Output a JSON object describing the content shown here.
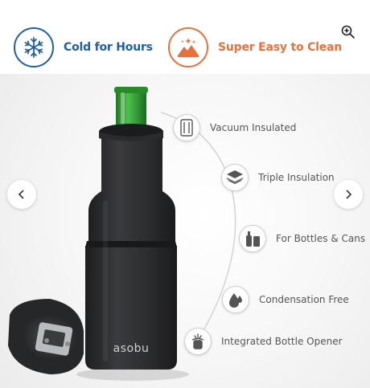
{
  "badges": {
    "cold": {
      "label": "Cold for Hours",
      "icon": "snowflake-icon",
      "color": "#1f5fa8"
    },
    "clean": {
      "label": "Super Easy to Clean",
      "icon": "sparkle-mountain-icon",
      "color": "#e8703a"
    }
  },
  "controls": {
    "zoom_icon": "zoom-in-icon",
    "prev_icon": "chevron-left-icon",
    "next_icon": "chevron-right-icon"
  },
  "product": {
    "brand": "asobu",
    "bottle_color": "#2c2d2f",
    "neck_color": "#2e9e2e"
  },
  "features": [
    {
      "label": "Vacuum Insulated",
      "icon": "vacuum-wall-icon"
    },
    {
      "label": "Triple Insulation",
      "icon": "layers-icon"
    },
    {
      "label": "For Bottles & Cans",
      "icon": "bottle-can-icon"
    },
    {
      "label": "Condensation Free",
      "icon": "droplets-icon"
    },
    {
      "label": "Integrated Bottle Opener",
      "icon": "bottle-opener-icon"
    }
  ]
}
